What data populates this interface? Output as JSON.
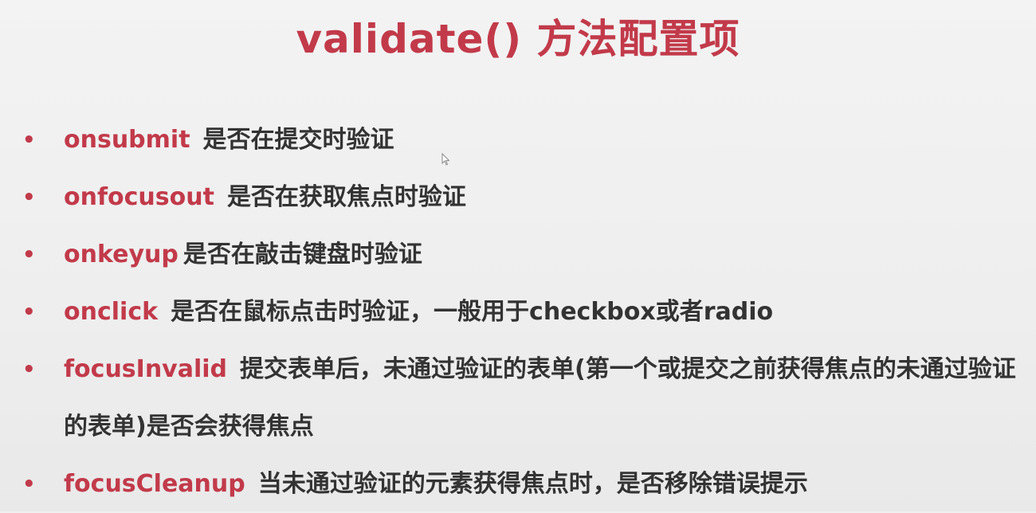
{
  "title": "validate() 方法配置项",
  "colors": {
    "accent": "#c23a4a",
    "text": "#333333",
    "background": "#efefef"
  },
  "items": [
    {
      "key": "onsubmit",
      "desc": "是否在提交时验证"
    },
    {
      "key": "onfocusout",
      "desc": "是否在获取焦点时验证"
    },
    {
      "key": "onkeyup",
      "desc": "是否在敲击键盘时验证"
    },
    {
      "key": "onclick",
      "desc": "是否在鼠标点击时验证，一般用于checkbox或者radio"
    },
    {
      "key": "focusInvalid",
      "desc": "提交表单后，未通过验证的表单(第一个或提交之前获得焦点的未通过验证的表单)是否会获得焦点"
    },
    {
      "key": "focusCleanup",
      "desc": "当未通过验证的元素获得焦点时，是否移除错误提示"
    }
  ],
  "bullet": "•"
}
